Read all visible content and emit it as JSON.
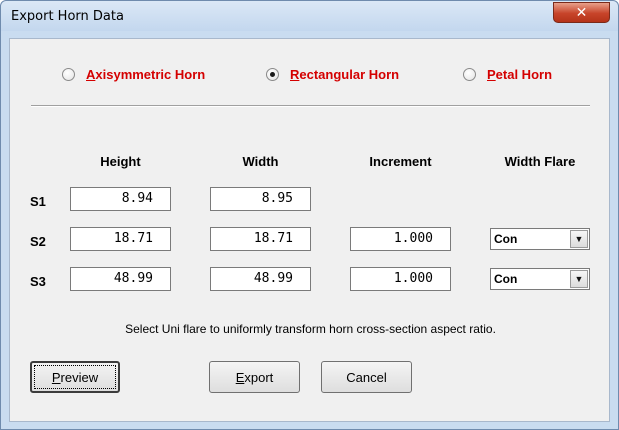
{
  "window": {
    "title": "Export Horn Data",
    "close_glyph": "✕"
  },
  "horn_type": {
    "options": [
      {
        "accel": "A",
        "rest": "xisymmetric Horn",
        "checked": false
      },
      {
        "accel": "R",
        "rest": "ectangular Horn",
        "checked": true
      },
      {
        "accel": "P",
        "rest": "etal Horn",
        "checked": false
      }
    ],
    "label_color": "#d40000"
  },
  "columns": {
    "height": "Height",
    "width": "Width",
    "increment": "Increment",
    "width_flare": "Width Flare"
  },
  "rows": [
    {
      "label": "S1",
      "height": "8.94",
      "width": "8.95"
    },
    {
      "label": "S2",
      "height": "18.71",
      "width": "18.71",
      "increment": "1.000",
      "flare": "Con"
    },
    {
      "label": "S3",
      "height": "48.99",
      "width": "48.99",
      "increment": "1.000",
      "flare": "Con"
    }
  ],
  "hint": "Select Uni flare to uniformly transform horn cross-section aspect ratio.",
  "buttons": {
    "preview": {
      "accel": "P",
      "rest": "review"
    },
    "export": {
      "accel": "E",
      "rest": "xport"
    },
    "cancel": {
      "label": "Cancel"
    }
  },
  "icons": {
    "dropdown": "chevron-down-icon",
    "close": "close-icon"
  }
}
